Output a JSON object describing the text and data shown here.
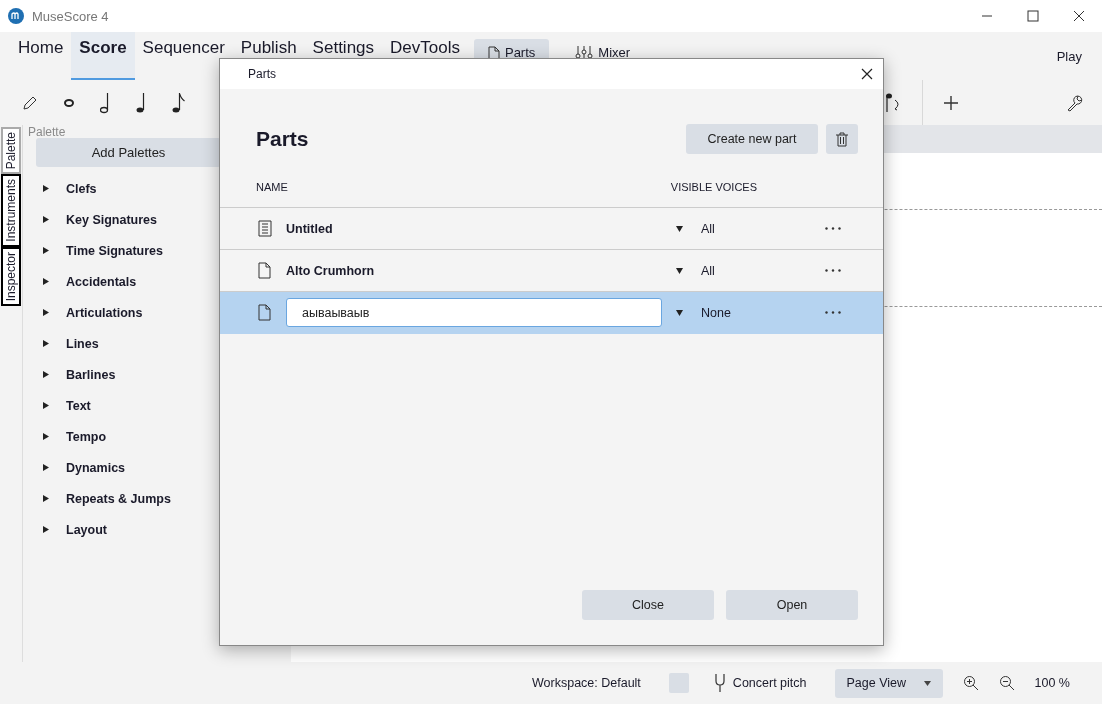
{
  "window": {
    "title": "MuseScore 4"
  },
  "nav_tabs": [
    {
      "label": "Home",
      "selected": false
    },
    {
      "label": "Score",
      "selected": true
    },
    {
      "label": "Sequencer",
      "selected": false
    },
    {
      "label": "Publish",
      "selected": false
    },
    {
      "label": "Settings",
      "selected": false
    },
    {
      "label": "DevTools",
      "selected": false
    }
  ],
  "top_buttons": [
    {
      "label": "Parts",
      "kind": "parts",
      "selected": true
    },
    {
      "label": "Mixer",
      "kind": "mixer",
      "selected": false
    }
  ],
  "play_label": "Play",
  "side_tabs": [
    {
      "label": "Palette",
      "selected": true
    },
    {
      "label": "Instruments",
      "selected": false
    },
    {
      "label": "Inspector",
      "selected": false
    }
  ],
  "palette": {
    "title": "Palette",
    "add_button": "Add Palettes",
    "items": [
      "Clefs",
      "Key Signatures",
      "Time Signatures",
      "Accidentals",
      "Articulations",
      "Lines",
      "Barlines",
      "Text",
      "Tempo",
      "Dynamics",
      "Repeats & Jumps",
      "Layout"
    ]
  },
  "dialog": {
    "title": "Parts",
    "heading": "Parts",
    "create_button": "Create new part",
    "columns": [
      "NAME",
      "VISIBLE VOICES"
    ],
    "parts": [
      {
        "name": "Untitled",
        "kind": "score",
        "voices": "All",
        "selected": false,
        "editing": false
      },
      {
        "name": "Alto Crumhorn",
        "kind": "part",
        "voices": "All",
        "selected": false,
        "editing": false
      },
      {
        "name": "аываываыв",
        "kind": "part",
        "voices": "None",
        "selected": true,
        "editing": true
      }
    ],
    "buttons": [
      "Close",
      "Open"
    ]
  },
  "status_bar": {
    "workspace": "Workspace: Default",
    "concert_pitch": {
      "label": "Concert pitch",
      "checked": false
    },
    "view": "Page View",
    "zoom": "100 %"
  }
}
